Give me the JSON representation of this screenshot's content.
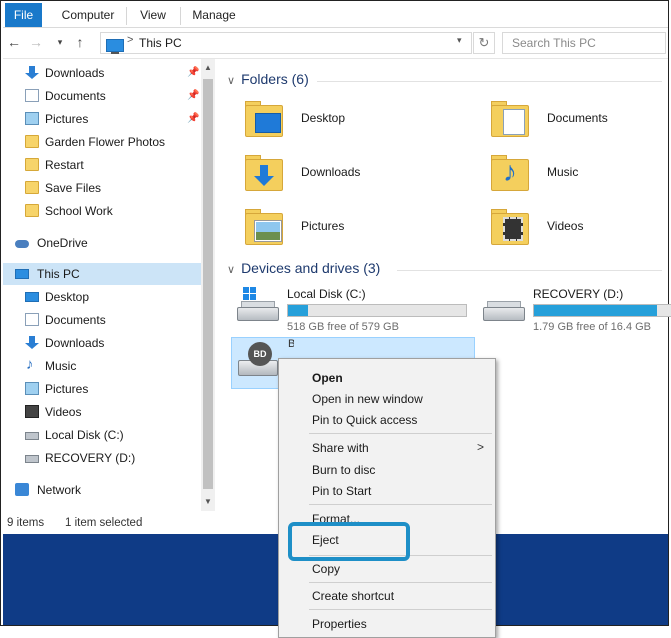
{
  "ribbon": {
    "tabs": [
      "File",
      "Computer",
      "View",
      "Manage"
    ]
  },
  "address": {
    "path": "This PC",
    "separator": ">",
    "search_placeholder": "Search This PC"
  },
  "nav": {
    "quick_access": [
      {
        "label": "Downloads",
        "icon": "download-icon",
        "pinned": true
      },
      {
        "label": "Documents",
        "icon": "documents-icon",
        "pinned": true
      },
      {
        "label": "Pictures",
        "icon": "pictures-icon",
        "pinned": true
      },
      {
        "label": "Garden Flower Photos",
        "icon": "folder-icon"
      },
      {
        "label": "Restart",
        "icon": "folder-icon"
      },
      {
        "label": "Save Files",
        "icon": "folder-icon"
      },
      {
        "label": "School Work",
        "icon": "folder-icon"
      }
    ],
    "onedrive": "OneDrive",
    "this_pc": "This PC",
    "this_pc_items": [
      {
        "label": "Desktop",
        "icon": "desktop-icon"
      },
      {
        "label": "Documents",
        "icon": "documents-icon"
      },
      {
        "label": "Downloads",
        "icon": "download-icon"
      },
      {
        "label": "Music",
        "icon": "music-icon"
      },
      {
        "label": "Pictures",
        "icon": "pictures-icon"
      },
      {
        "label": "Videos",
        "icon": "videos-icon"
      },
      {
        "label": "Local Disk (C:)",
        "icon": "disk-icon"
      },
      {
        "label": "RECOVERY (D:)",
        "icon": "disk-icon"
      }
    ],
    "network": "Network"
  },
  "status": {
    "items": "9 items",
    "selected": "1 item selected"
  },
  "main": {
    "folders_header": "Folders (6)",
    "folders": [
      {
        "label": "Desktop",
        "icon": "desktop-folder-icon"
      },
      {
        "label": "Documents",
        "icon": "documents-folder-icon"
      },
      {
        "label": "Downloads",
        "icon": "downloads-folder-icon"
      },
      {
        "label": "Music",
        "icon": "music-folder-icon"
      },
      {
        "label": "Pictures",
        "icon": "pictures-folder-icon"
      },
      {
        "label": "Videos",
        "icon": "videos-folder-icon"
      }
    ],
    "devices_header": "Devices and drives (3)",
    "drives": [
      {
        "label": "Local Disk (C:)",
        "free": "518 GB free of 579 GB",
        "used_fraction": 0.11
      },
      {
        "label": "RECOVERY (D:)",
        "free": "1.79 GB free of 16.4 GB",
        "used_fraction": 0.89
      }
    ],
    "disc_drive": {
      "label": "BD-ROM Drive (E:)",
      "badge": "BD"
    }
  },
  "context_menu": {
    "items": [
      {
        "label": "Open",
        "bold": true
      },
      {
        "label": "Open in new window"
      },
      {
        "label": "Pin to Quick access"
      },
      {
        "label": "Share with",
        "submenu": true
      },
      {
        "label": "Burn to disc"
      },
      {
        "label": "Pin to Start"
      },
      {
        "label": "Format..."
      },
      {
        "label": "Eject",
        "highlighted": true
      },
      {
        "label": "Copy"
      },
      {
        "label": "Create shortcut"
      },
      {
        "label": "Properties"
      }
    ],
    "submenu_glyph": ">"
  },
  "colors": {
    "file_tab": "#1979ca",
    "selection": "#cce4f7",
    "drive_bar": "#26a0da",
    "highlight_box": "#1e8fc7",
    "background_blue": "#0f3b86"
  }
}
